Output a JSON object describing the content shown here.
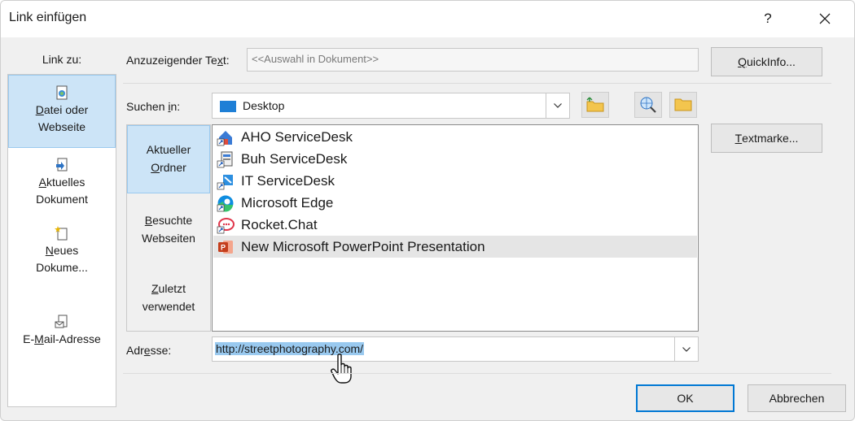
{
  "window": {
    "title": "Link einfügen",
    "help_label": "?"
  },
  "sidebar": {
    "heading": "Link zu:",
    "items": [
      {
        "line1": "Datei oder",
        "line2": "Webseite",
        "underline_char": "D",
        "selected": true
      },
      {
        "line1": "Aktuelles",
        "line2": "Dokument",
        "underline_char": "A",
        "selected": false
      },
      {
        "line1": "Neues",
        "line2": "Dokume...",
        "underline_char": "N",
        "selected": false
      },
      {
        "line1": "E-Mail-Adresse",
        "line2": "",
        "underline_char": "M",
        "selected": false
      }
    ]
  },
  "display_text": {
    "label_pre": "Anzuzeigender Te",
    "label_u": "x",
    "label_post": "t:",
    "value": "<<Auswahl in Dokument>>"
  },
  "quickinfo_button": {
    "label_u": "Q",
    "label_rest": "uickInfo..."
  },
  "search": {
    "label_pre": "Suchen ",
    "label_u": "i",
    "label_post": "n:",
    "value": "Desktop"
  },
  "places": [
    {
      "line1": "Aktueller",
      "line2": "Ordner",
      "selected": true
    },
    {
      "line1": "Besuchte",
      "line2": "Webseiten",
      "selected": false
    },
    {
      "line1": "Zuletzt",
      "line2": "verwendet",
      "selected": false
    }
  ],
  "files": [
    {
      "name": "AHO ServiceDesk",
      "icon": "shortcut-icon"
    },
    {
      "name": "Buh ServiceDesk",
      "icon": "shortcut-icon"
    },
    {
      "name": "IT ServiceDesk",
      "icon": "shortcut-icon"
    },
    {
      "name": "Microsoft Edge",
      "icon": "edge-icon"
    },
    {
      "name": "Rocket.Chat",
      "icon": "rocketchat-icon"
    },
    {
      "name": "New Microsoft PowerPoint Presentation",
      "icon": "powerpoint-icon"
    }
  ],
  "textmarke_button": {
    "label_u": "T",
    "label_rest": "extmarke..."
  },
  "address": {
    "label_pre": "Adr",
    "label_u": "e",
    "label_post": "sse:",
    "value": "http://streetphotography.com/"
  },
  "ok_button": {
    "label": "OK"
  },
  "cancel_button": {
    "label": "Abbrechen"
  },
  "colors": {
    "accent": "#0078d4",
    "selection": "#cce4f7",
    "address_highlight": "#99c9ef"
  }
}
